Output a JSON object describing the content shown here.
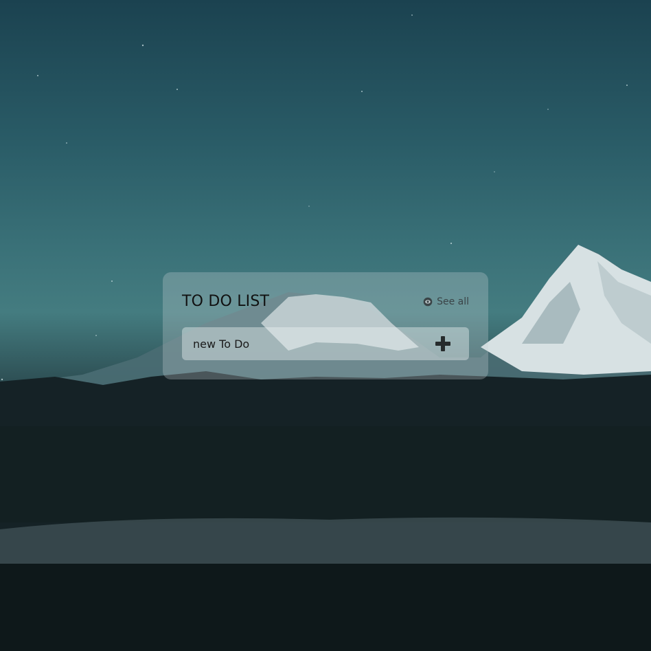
{
  "todo_card": {
    "title": "TO DO LIST",
    "see_all_label": "See all",
    "see_all_icon": "eye-icon",
    "add_icon": "plus-icon",
    "input": {
      "placeholder": "new To Do",
      "value": ""
    }
  },
  "colors": {
    "sky_top": "#1b4250",
    "sky_horizon": "#447c80",
    "ground": "#111d20",
    "snow": "#dfe8ea",
    "text_dark": "#111111"
  }
}
